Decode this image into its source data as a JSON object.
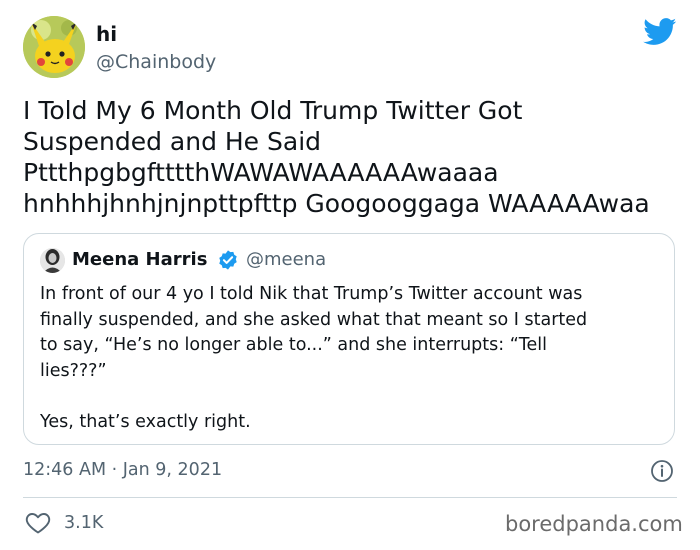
{
  "tweet": {
    "author_name": "hi",
    "author_handle": "@Chainbody",
    "text_lines": [
      "I Told My 6 Month Old Trump Twitter Got",
      "Suspended and He Said",
      "PttthpgbgftttthWAWAWAAAAAAwaaaa",
      "hnhhhjhnhjnjnpttpfttp Googooggaga WAAAAAwaa"
    ],
    "timestamp": "12:46 AM · Jan 9, 2021",
    "like_count": "3.1K"
  },
  "quoted_tweet": {
    "author_name": "Meena Harris",
    "author_handle": "@meena",
    "verified": true,
    "text_lines": [
      "In front of our 4 yo I told Nik that Trump’s Twitter account was",
      "finally suspended, and she asked what that meant so I started",
      "to say, “He’s no longer able to...” and she interrupts: “Tell",
      "lies???”",
      "",
      "Yes, that’s exactly right."
    ]
  },
  "watermark": "boredpanda.com",
  "icons": {
    "brand": "twitter-bird-icon",
    "verified": "verified-badge-icon",
    "info": "info-icon",
    "like": "heart-icon"
  },
  "colors": {
    "twitter_blue": "#1d9bf0",
    "secondary_text": "#536471",
    "border": "#cfd9de"
  }
}
